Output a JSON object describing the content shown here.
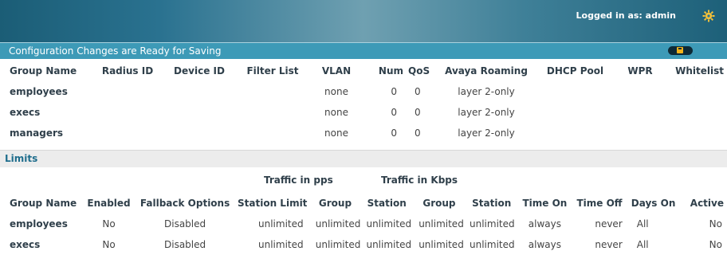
{
  "header": {
    "login_text": "Logged in as: admin",
    "gear_icon": "gear-icon"
  },
  "savebar": {
    "message": "Configuration Changes are Ready for Saving",
    "save_icon": "save-disk-icon"
  },
  "groups": {
    "columns": [
      "Group Name",
      "Radius ID",
      "Device ID",
      "Filter List",
      "VLAN",
      "Num",
      "QoS",
      "Avaya Roaming",
      "DHCP Pool",
      "WPR",
      "Whitelist"
    ],
    "rows": [
      [
        "employees",
        "",
        "",
        "",
        "none",
        "0",
        "0",
        "layer 2-only",
        "",
        "",
        ""
      ],
      [
        "execs",
        "",
        "",
        "",
        "none",
        "0",
        "0",
        "layer 2-only",
        "",
        "",
        ""
      ],
      [
        "managers",
        "",
        "",
        "",
        "none",
        "0",
        "0",
        "layer 2-only",
        "",
        "",
        ""
      ]
    ]
  },
  "limits": {
    "section_title": "Limits",
    "traffic_pps": "Traffic in pps",
    "traffic_kbps": "Traffic in Kbps",
    "columns": [
      "Group Name",
      "Enabled",
      "Fallback Options",
      "Station Limit",
      "Group",
      "Station",
      "Group",
      "Station",
      "Time On",
      "Time Off",
      "Days On",
      "Active"
    ],
    "rows": [
      [
        "employees",
        "No",
        "Disabled",
        "unlimited",
        "unlimited",
        "unlimited",
        "unlimited",
        "unlimited",
        "always",
        "never",
        "All",
        "No"
      ],
      [
        "execs",
        "No",
        "Disabled",
        "unlimited",
        "unlimited",
        "unlimited",
        "unlimited",
        "unlimited",
        "always",
        "never",
        "All",
        "No"
      ]
    ]
  }
}
